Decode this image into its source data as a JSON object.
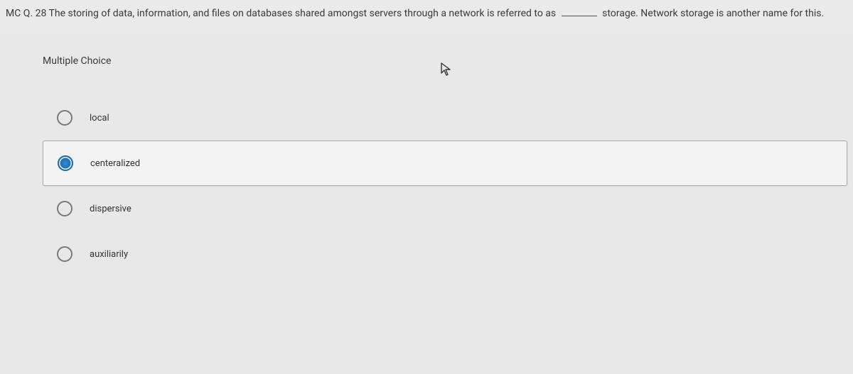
{
  "question": {
    "prefix": "MC Q. 28 The storing of data, information, and files on databases shared amongst servers through a network is referred to as",
    "suffix": " storage. Network storage is another name for this."
  },
  "section_label": "Multiple Choice",
  "options": [
    {
      "label": "local",
      "selected": false
    },
    {
      "label": "centeralized",
      "selected": true
    },
    {
      "label": "dispersive",
      "selected": false
    },
    {
      "label": "auxiliarily",
      "selected": false
    }
  ]
}
